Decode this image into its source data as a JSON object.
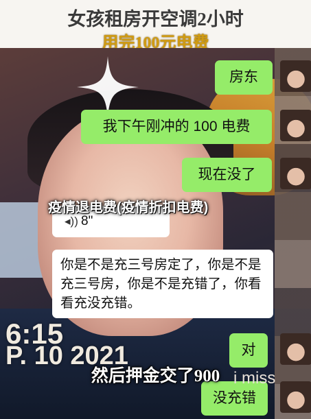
{
  "headline": {
    "line1": "女孩租房开空调2小时",
    "line2": "用完100元电费"
  },
  "banner": "疫情退电费(疫情折扣电费)",
  "messages": [
    {
      "side": "right",
      "text": "房东"
    },
    {
      "side": "right",
      "text": "我下午刚冲的 100 电费"
    },
    {
      "side": "right",
      "text": "现在没了"
    },
    {
      "side": "left",
      "type": "voice",
      "duration": "8\""
    },
    {
      "side": "left",
      "text": "你是不是充三号房定了，你是不是充三号房，你是不是充错了，你看看充没充错。"
    },
    {
      "side": "right",
      "text": "对"
    },
    {
      "side": "right",
      "text": "没充错"
    }
  ],
  "overlay_time": {
    "line1": "6:15",
    "line2": "P. 10 2021"
  },
  "overlay_miss": "i miss",
  "subtitle": "然后押金交了900",
  "colors": {
    "bubble_green": "#95ec69",
    "bubble_white": "#ffffff",
    "headline_gold": "#d09b12"
  },
  "icons": {
    "voice": "voice-wave-icon",
    "sparkle": "sparkle-icon"
  }
}
